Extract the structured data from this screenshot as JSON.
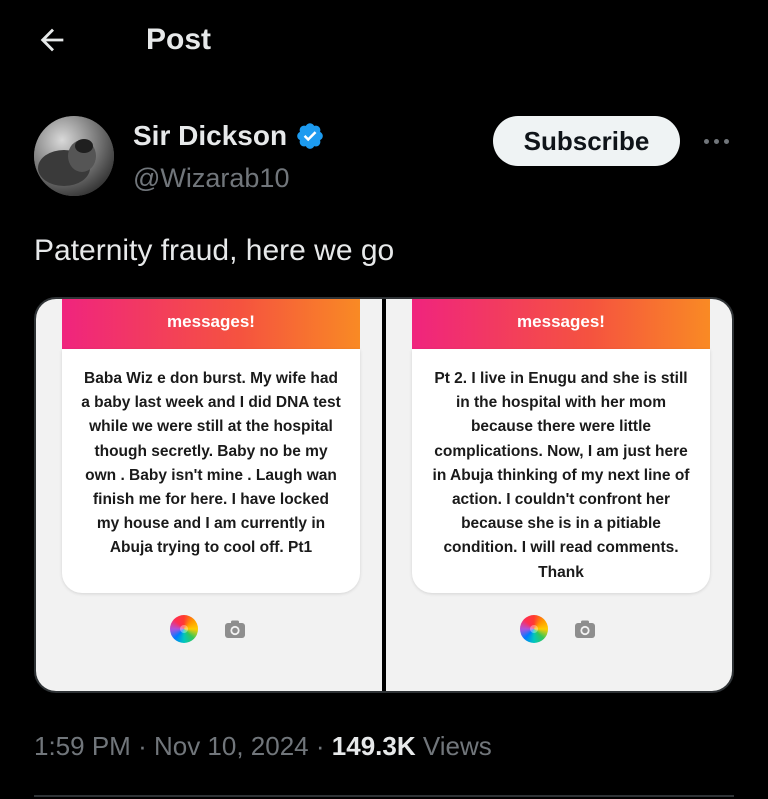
{
  "header": {
    "title": "Post",
    "back_icon": "arrow-left-icon"
  },
  "author": {
    "name": "Sir Dickson",
    "handle": "@Wizarab10",
    "verified_color": "#1d9bf0",
    "avatar": "avatar-photo"
  },
  "actions": {
    "subscribe_label": "Subscribe",
    "more_icon": "more-horizontal-icon"
  },
  "post": {
    "text": "Paternity fraud, here we go",
    "media": [
      {
        "header_label": "messages!",
        "message": "Baba Wiz e don burst. My wife had a baby last week and I did DNA test while we were still at the hospital though secretly. Baby no be my own . Baby isn't mine . Laugh wan finish me for here. I have locked my house and I am currently in Abuja trying to cool off. Pt1"
      },
      {
        "header_label": "messages!",
        "message": "Pt 2. I live in Enugu and she is still in the hospital with her mom because there were little complications. Now, I am just here in Abuja thinking of my next line of action. I couldn't confront her because she is in a pitiable condition. I will read comments. Thank"
      }
    ]
  },
  "meta": {
    "time": "1:59 PM",
    "sep1": "·",
    "date": "Nov 10, 2024",
    "sep2": "·",
    "views_count": "149.3K",
    "views_label": "Views"
  },
  "colors": {
    "background": "#000000",
    "text": "#e7e9ea",
    "muted": "#71767b",
    "accent": "#1d9bf0"
  }
}
